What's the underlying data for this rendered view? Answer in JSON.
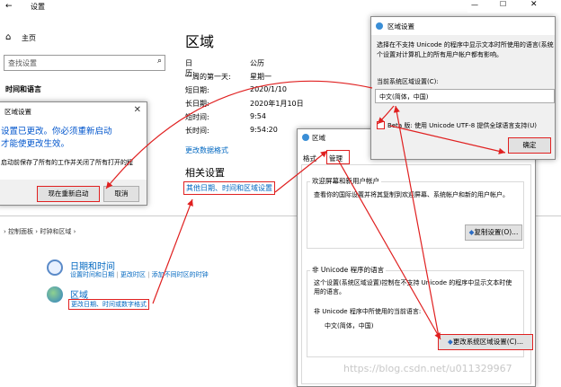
{
  "settings": {
    "title": "设置",
    "home": "主页",
    "search_placeholder": "查找设置",
    "category": "时间和语言",
    "page_title": "区域",
    "formats": [
      {
        "label": "日历:",
        "value": "公历"
      },
      {
        "label": "一周的第一天:",
        "value": "星期一"
      },
      {
        "label": "短日期:",
        "value": "2020/1/10"
      },
      {
        "label": "长日期:",
        "value": "2020年1月10日"
      },
      {
        "label": "短时间:",
        "value": "9:54"
      },
      {
        "label": "长时间:",
        "value": "9:54:20"
      }
    ],
    "change_link": "更改数据格式",
    "related_heading": "相关设置",
    "related_link": "其他日期、时间和区域设置"
  },
  "restart_dialog": {
    "title": "区域设置",
    "message_line1": "设置已更改。你必须重新启动",
    "message_line2": "才能使更改生效。",
    "sub_message": "启动前保存了所有的工作并关闭了所有打开的程",
    "restart_button": "现在重新启动",
    "cancel_button": "取消"
  },
  "region_settings_dialog": {
    "title": "区域设置",
    "description_line1": "选择在不支持 Unicode 的程序中显示文本时所使用的语言(系统",
    "description_line2": "个设置对计算机上的所有用户帐户都有影响。",
    "current_label": "当前系统区域设置(C):",
    "current_value": "中文(简体，中国)",
    "beta_label": "Beta 版: 使用 Unicode UTF-8 提供全球语言支持(U)",
    "ok_button": "确定"
  },
  "control_panel": {
    "breadcrumb": [
      "控制面板",
      "时钟和区域"
    ],
    "datetime_title": "日期和时间",
    "datetime_links": [
      "设置时间和日期",
      "更改时区",
      "添加不同时区的时钟"
    ],
    "region_title": "区域",
    "region_link": "更改日期、时间或数字格式"
  },
  "region_dialog": {
    "title": "区域",
    "tabs": [
      "格式",
      "管理"
    ],
    "welcome_legend": "欢迎屏幕和新用户帐户",
    "welcome_text": "查看你的国际设置并将其复制到欢迎屏幕、系统帐户和新的用户帐户。",
    "copy_button": "复制设置(O)...",
    "nonunicode_legend": "非 Unicode 程序的语言",
    "nonunicode_text": "这个设置(系统区域设置)控制在不支持 Unicode 的程序中显示文本时使用的语言。",
    "current_lang_label": "非 Unicode 程序中所使用的当前语言:",
    "current_lang_value": "中文(简体，中国)",
    "change_locale_button": "更改系统区域设置(C)..."
  },
  "watermark": "https://blog.csdn.net/u011329967",
  "window_controls": {
    "minimize": "—",
    "maximize": "☐",
    "close": "✕"
  }
}
